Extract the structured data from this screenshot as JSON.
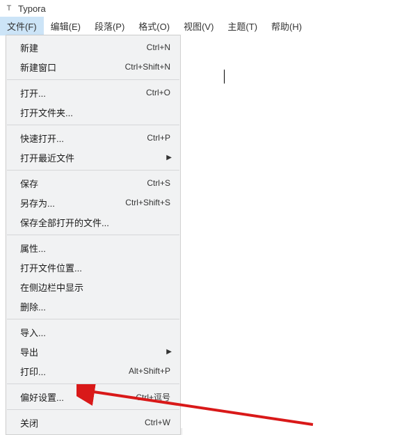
{
  "title_bar": {
    "icon_text": "T",
    "app_name": "Typora"
  },
  "menu_bar": {
    "items": [
      {
        "label": "文件(F)"
      },
      {
        "label": "编辑(E)"
      },
      {
        "label": "段落(P)"
      },
      {
        "label": "格式(O)"
      },
      {
        "label": "视图(V)"
      },
      {
        "label": "主题(T)"
      },
      {
        "label": "帮助(H)"
      }
    ]
  },
  "dropdown": {
    "groups": [
      [
        {
          "label": "新建",
          "shortcut": "Ctrl+N",
          "submenu": false
        },
        {
          "label": "新建窗口",
          "shortcut": "Ctrl+Shift+N",
          "submenu": false
        }
      ],
      [
        {
          "label": "打开...",
          "shortcut": "Ctrl+O",
          "submenu": false
        },
        {
          "label": "打开文件夹...",
          "shortcut": "",
          "submenu": false
        }
      ],
      [
        {
          "label": "快速打开...",
          "shortcut": "Ctrl+P",
          "submenu": false
        },
        {
          "label": "打开最近文件",
          "shortcut": "",
          "submenu": true
        }
      ],
      [
        {
          "label": "保存",
          "shortcut": "Ctrl+S",
          "submenu": false
        },
        {
          "label": "另存为...",
          "shortcut": "Ctrl+Shift+S",
          "submenu": false
        },
        {
          "label": "保存全部打开的文件...",
          "shortcut": "",
          "submenu": false
        }
      ],
      [
        {
          "label": "属性...",
          "shortcut": "",
          "submenu": false
        },
        {
          "label": "打开文件位置...",
          "shortcut": "",
          "submenu": false
        },
        {
          "label": "在侧边栏中显示",
          "shortcut": "",
          "submenu": false
        },
        {
          "label": "删除...",
          "shortcut": "",
          "submenu": false
        }
      ],
      [
        {
          "label": "导入...",
          "shortcut": "",
          "submenu": false
        },
        {
          "label": "导出",
          "shortcut": "",
          "submenu": true
        },
        {
          "label": "打印...",
          "shortcut": "Alt+Shift+P",
          "submenu": false
        }
      ],
      [
        {
          "label": "偏好设置...",
          "shortcut": "Ctrl+逗号",
          "submenu": false
        }
      ],
      [
        {
          "label": "关闭",
          "shortcut": "Ctrl+W",
          "submenu": false
        }
      ]
    ]
  }
}
